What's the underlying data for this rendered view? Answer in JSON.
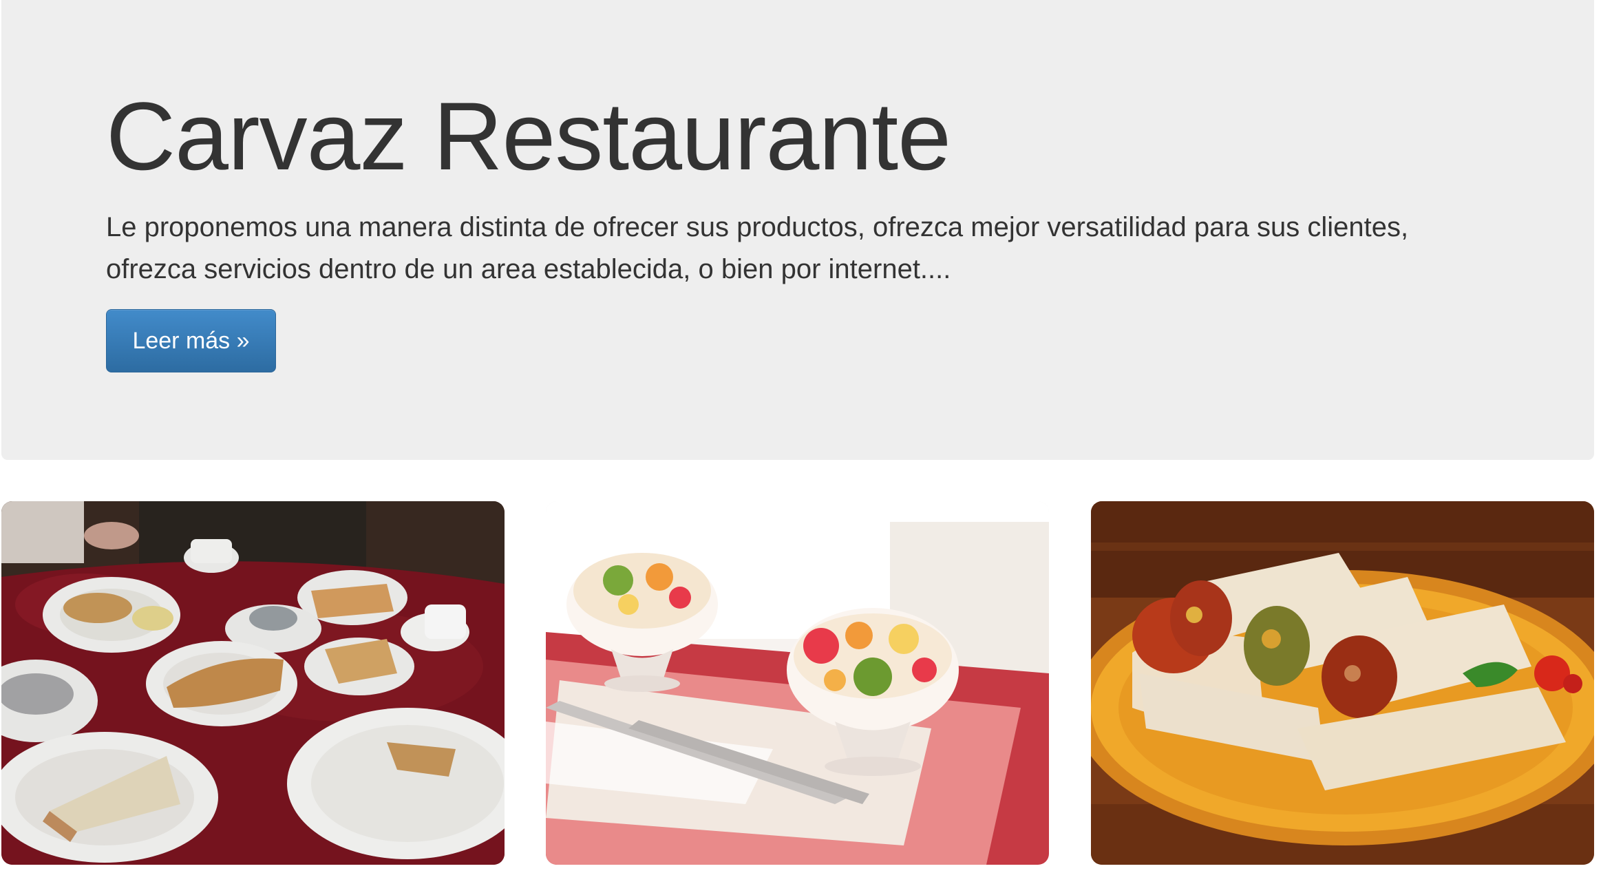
{
  "jumbotron": {
    "title": "Carvaz Restaurante",
    "lead": "Le proponemos una manera distinta de ofrecer sus productos, ofrezca mejor versatilidad para sus clientes, ofrezca servicios dentro de un area establecida, o bien por internet....",
    "button_label": "Leer más »"
  },
  "colors": {
    "jumbotron_bg": "#eeeeee",
    "title_text": "#333333",
    "button_bg": "#337ab7"
  },
  "gallery": [
    {
      "name": "breakfast-table-photo"
    },
    {
      "name": "fruit-salad-photo"
    },
    {
      "name": "burritos-photo"
    }
  ]
}
